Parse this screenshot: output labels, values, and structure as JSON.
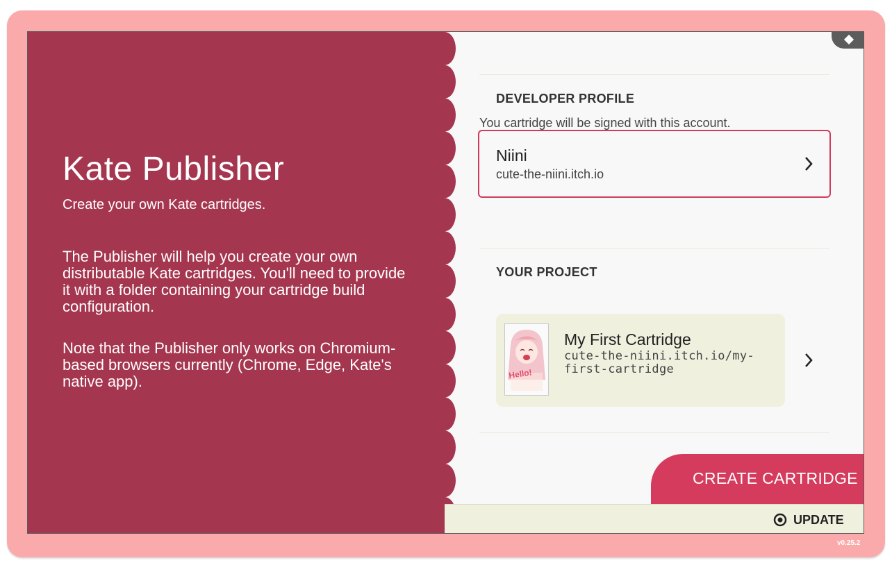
{
  "app": {
    "title": "Kate Publisher",
    "subtitle": "Create your own Kate cartridges.",
    "description_1": "The Publisher will help you create your own distributable Kate cartridges. You'll need to provide it with a folder containing your cartridge build configuration.",
    "description_2": "Note that the Publisher only works on Chromium-based browsers currently (Chrome, Edge, Kate's native app)."
  },
  "developer_profile": {
    "heading": "DEVELOPER PROFILE",
    "description": "You cartridge will be signed with this account.",
    "name": "Niini",
    "domain": "cute-the-niini.itch.io"
  },
  "project": {
    "heading": "YOUR PROJECT",
    "title": "My First Cartridge",
    "url": "cute-the-niini.itch.io/my-first-cartridge",
    "thumbnail_text": "Hello!"
  },
  "actions": {
    "create_label": "CREATE CARTRIDGE",
    "update_label": "UPDATE"
  },
  "version": "v0.25.2",
  "colors": {
    "console_pink": "#fbaaab",
    "sidebar_crimson": "#a5364f",
    "accent": "#d43b5c",
    "card_cream": "#f0f0df"
  },
  "icons": {
    "corner": "diamond-icon",
    "profile_chevron": "chevron-right-icon",
    "project_chevron": "chevron-right-icon",
    "update": "radio-target-icon"
  }
}
